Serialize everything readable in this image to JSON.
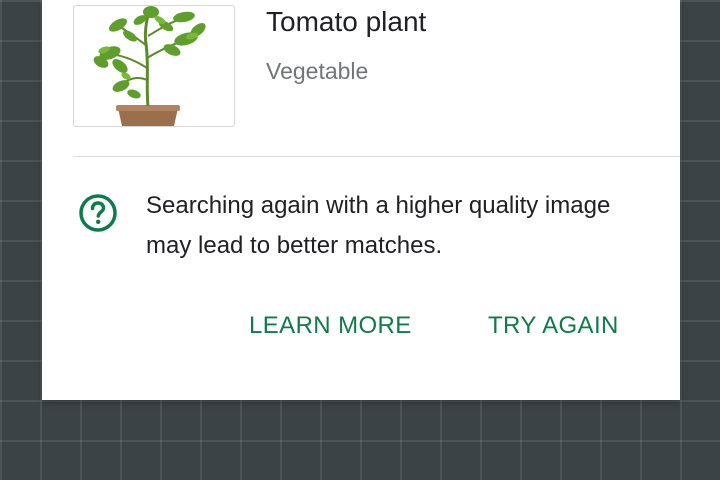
{
  "result": {
    "title": "Tomato plant",
    "subtitle": "Vegetable",
    "thumbnail_icon": "tomato-plant-image"
  },
  "help": {
    "icon": "help-circle-icon",
    "message": "Searching again with a higher quality image may lead to better matches."
  },
  "actions": {
    "learn_more": "LEARN MORE",
    "try_again": "TRY AGAIN"
  },
  "colors": {
    "accent": "#0f7b4a",
    "title_text": "#202124",
    "subtitle_text": "#70757a",
    "card_bg": "#ffffff",
    "page_bg": "#3b4346",
    "divider": "#dadce0"
  }
}
